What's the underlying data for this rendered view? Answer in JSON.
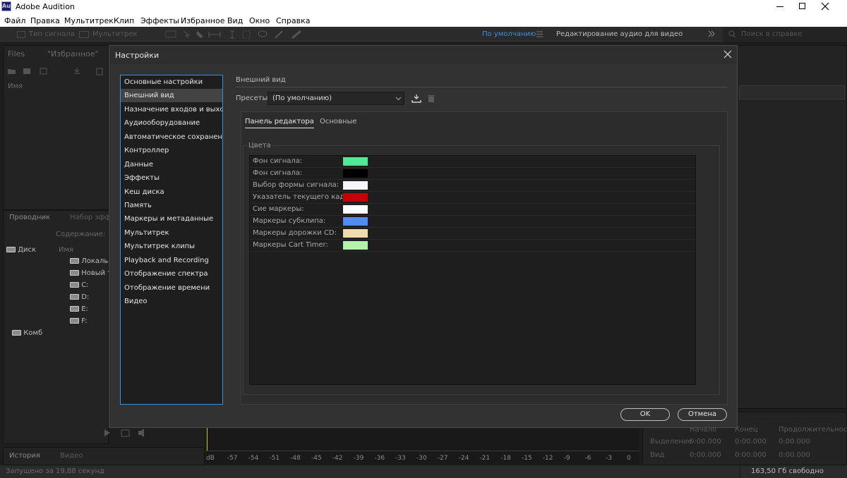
{
  "app": {
    "title": "Adobe Audition",
    "logo_text": "Au"
  },
  "menu": [
    "Файл",
    "Правка",
    "Мультитрек",
    "Клип",
    "Эффекты",
    "Избранное",
    "Вид",
    "Окно",
    "Справка"
  ],
  "toolbar": {
    "waveform_label": "Тип сигнала",
    "multitrack_label": "Мультитрек",
    "workspace_default": "По умолчанию",
    "workspace_video": "Редактирование аудио для видео",
    "search_placeholder": "Поиск в справке"
  },
  "files_panel": {
    "tab_files": "Files",
    "tab_favorites": "\"Избранное\"",
    "col_name": "Имя"
  },
  "browser_panel": {
    "tab_explorer": "Проводник",
    "tab_effects": "Набор эффе",
    "contents_label": "Содержание:",
    "col_name": "Имя",
    "tree": [
      "Диск",
      "Комб"
    ],
    "items": [
      "Локальн",
      "Новый т",
      "C:",
      "D:",
      "E:",
      "F:"
    ]
  },
  "history_panel": {
    "tab_history": "История",
    "tab_video": "Видео"
  },
  "selection_panel": {
    "col_start": "Начало",
    "col_end": "Конец",
    "col_duration": "Продолжительность",
    "rows": [
      {
        "label": "Выделение",
        "start": "0:00.000",
        "end": "0:00.000",
        "duration": "0:00.000"
      },
      {
        "label": "Вид",
        "start": "0:00.000",
        "end": "0:00.000",
        "duration": "0:00.000"
      }
    ]
  },
  "meter": {
    "ticks": [
      "dB",
      "-57",
      "-54",
      "-51",
      "-48",
      "-45",
      "-42",
      "-39",
      "-36",
      "-33",
      "-30",
      "-27",
      "-24",
      "-21",
      "-18",
      "-15",
      "-12",
      "-9",
      "-6",
      "-3",
      "0"
    ]
  },
  "status": {
    "left": "Запущено за 19,88 секунд",
    "right": "163,50 Гб свободно"
  },
  "dialog": {
    "title": "Настройки",
    "nav": [
      "Основные настройки",
      "Внешний вид",
      "Назначение входов и выходов",
      "Аудиооборудование",
      "Автоматическое сохранение",
      "Контроллер",
      "Данные",
      "Эффекты",
      "Кеш диска",
      "Память",
      "Маркеры и метаданные",
      "Мультитрек",
      "Мультитрек клипы",
      "Playback and Recording",
      "Отображение спектра",
      "Отображение времени",
      "Видео"
    ],
    "selected_nav": "Внешний вид",
    "section_title": "Внешний вид",
    "presets_label": "Пресеты:",
    "presets_value": "(По умолчанию)",
    "tabs": [
      "Панель редактора",
      "Основные"
    ],
    "group_title": "Цвета",
    "colors": [
      {
        "label": "Фон сигнала:",
        "color": "#4fe897"
      },
      {
        "label": "Фон сигнала:",
        "color": "#000000"
      },
      {
        "label": "Выбор формы сигнала:",
        "color": "#f4f5fc"
      },
      {
        "label": "Указатель текущего кадра:",
        "color": "#c40000"
      },
      {
        "label": "Сие маркеры:",
        "color": "#ffffff"
      },
      {
        "label": "Маркеры субклипа:",
        "color": "#4f8df0"
      },
      {
        "label": "Маркеры дорожки CD:",
        "color": "#f0dab0"
      },
      {
        "label": "Маркеры Cart Timer:",
        "color": "#b4f2ac"
      }
    ],
    "ok": "OK",
    "cancel": "Отмена"
  },
  "colors": {
    "accent": "#3c8fdc",
    "dialog_bg": "#323232",
    "panel_bg": "#232323"
  }
}
